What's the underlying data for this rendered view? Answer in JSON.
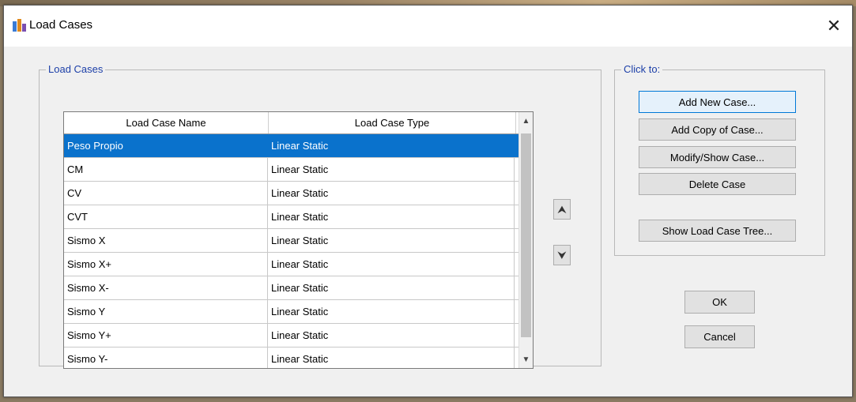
{
  "window": {
    "title": "Load Cases",
    "close_glyph": "✕"
  },
  "load_cases_group": {
    "label": "Load Cases",
    "columns": [
      "Load Case Name",
      "Load Case Type"
    ],
    "rows": [
      {
        "name": "Peso Propio",
        "type": "Linear Static",
        "selected": true
      },
      {
        "name": "CM",
        "type": "Linear Static"
      },
      {
        "name": "CV",
        "type": "Linear Static"
      },
      {
        "name": "CVT",
        "type": "Linear Static"
      },
      {
        "name": "Sismo X",
        "type": "Linear Static"
      },
      {
        "name": "Sismo X+",
        "type": "Linear Static"
      },
      {
        "name": "Sismo X-",
        "type": "Linear Static"
      },
      {
        "name": "Sismo Y",
        "type": "Linear Static"
      },
      {
        "name": "Sismo Y+",
        "type": "Linear Static"
      },
      {
        "name": "Sismo Y-",
        "type": "Linear Static"
      }
    ],
    "move_up_glyph": "⮝",
    "move_down_glyph": "⮟"
  },
  "click_to_group": {
    "label": "Click to:",
    "add_new": "Add New Case...",
    "add_copy": "Add Copy of Case...",
    "modify_show": "Modify/Show Case...",
    "delete": "Delete Case",
    "show_tree": "Show Load Case Tree..."
  },
  "footer": {
    "ok": "OK",
    "cancel": "Cancel"
  },
  "colors": {
    "selection": "#0a72cc",
    "group_label": "#1c3fa8",
    "focus_border": "#0078d7"
  },
  "icons": {
    "app": "load-cases-app-icon",
    "close": "close-icon",
    "move_up": "double-chevron-up-icon",
    "move_down": "double-chevron-down-icon",
    "scroll_up": "scroll-up-arrow-icon",
    "scroll_down": "scroll-down-arrow-icon"
  }
}
